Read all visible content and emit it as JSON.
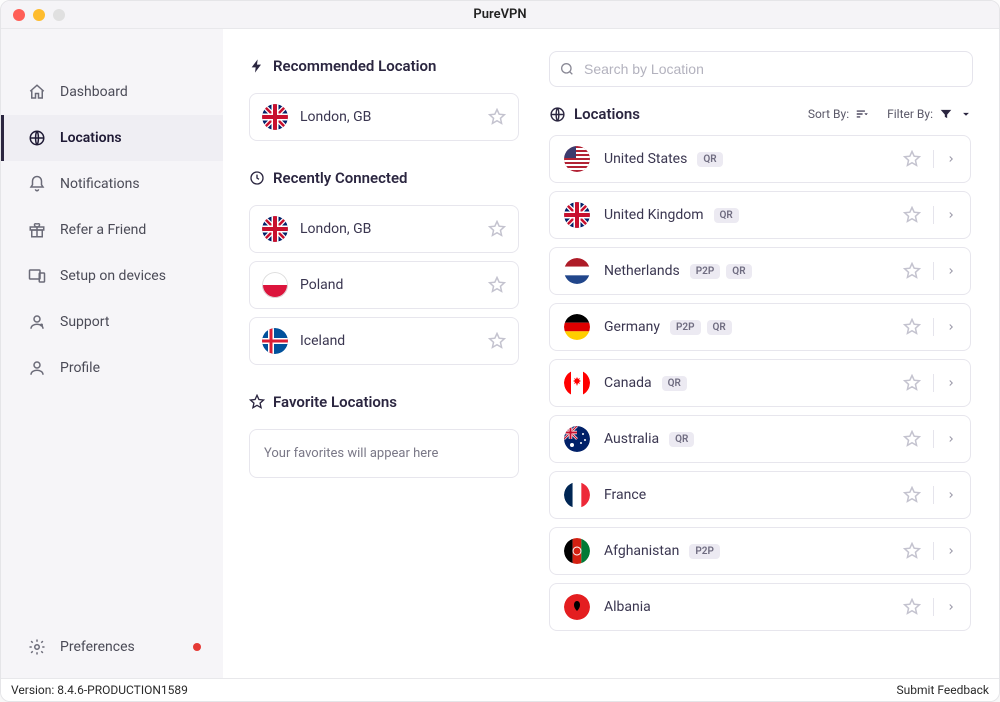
{
  "window": {
    "title": "PureVPN"
  },
  "sidebar": {
    "items": [
      {
        "id": "dashboard",
        "label": "Dashboard",
        "icon": "home"
      },
      {
        "id": "locations",
        "label": "Locations",
        "icon": "globe",
        "active": true
      },
      {
        "id": "notifications",
        "label": "Notifications",
        "icon": "bell"
      },
      {
        "id": "refer",
        "label": "Refer a Friend",
        "icon": "gift"
      },
      {
        "id": "setup",
        "label": "Setup on devices",
        "icon": "devices"
      },
      {
        "id": "support",
        "label": "Support",
        "icon": "support"
      },
      {
        "id": "profile",
        "label": "Profile",
        "icon": "user"
      }
    ],
    "bottom": {
      "label": "Preferences",
      "icon": "gear",
      "badge": true
    }
  },
  "sections": {
    "recommended": {
      "title": "Recommended Location"
    },
    "recent": {
      "title": "Recently Connected"
    },
    "favorites": {
      "title": "Favorite Locations",
      "empty_text": "Your favorites will appear here"
    },
    "locations": {
      "title": "Locations",
      "sort_label": "Sort By:",
      "filter_label": "Filter By:"
    }
  },
  "search": {
    "placeholder": "Search by Location"
  },
  "recommended": [
    {
      "name": "London, GB",
      "flag": "gb"
    }
  ],
  "recent": [
    {
      "name": "London, GB",
      "flag": "gb"
    },
    {
      "name": "Poland",
      "flag": "pl"
    },
    {
      "name": "Iceland",
      "flag": "is"
    }
  ],
  "countries": [
    {
      "name": "United States",
      "flag": "us",
      "tags": [
        "QR"
      ]
    },
    {
      "name": "United Kingdom",
      "flag": "gb",
      "tags": [
        "QR"
      ]
    },
    {
      "name": "Netherlands",
      "flag": "nl",
      "tags": [
        "P2P",
        "QR"
      ]
    },
    {
      "name": "Germany",
      "flag": "de",
      "tags": [
        "P2P",
        "QR"
      ]
    },
    {
      "name": "Canada",
      "flag": "ca",
      "tags": [
        "QR"
      ]
    },
    {
      "name": "Australia",
      "flag": "au",
      "tags": [
        "QR"
      ]
    },
    {
      "name": "France",
      "flag": "fr",
      "tags": []
    },
    {
      "name": "Afghanistan",
      "flag": "af",
      "tags": [
        "P2P"
      ]
    },
    {
      "name": "Albania",
      "flag": "al",
      "tags": []
    }
  ],
  "statusbar": {
    "version": "Version: 8.4.6-PRODUCTION1589",
    "feedback": "Submit Feedback"
  }
}
